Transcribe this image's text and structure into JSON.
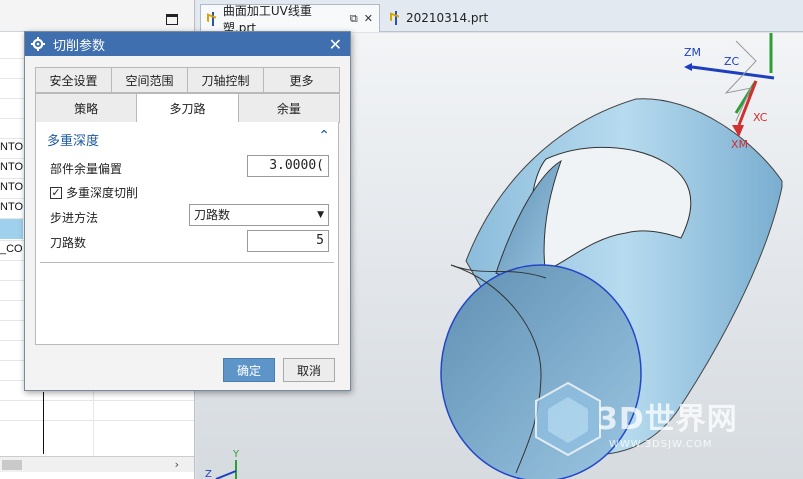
{
  "navigator": {
    "rows": [
      "NTO",
      "NTO",
      "NTO",
      "NTO",
      "_CO"
    ]
  },
  "tabs": [
    {
      "label": "曲面加工UV线重塑.prt",
      "active": true
    },
    {
      "label": "20210314.prt",
      "active": false
    }
  ],
  "dialog": {
    "title": "切削参数",
    "tabs_row1": [
      "安全设置",
      "空间范围",
      "刀轴控制",
      "更多"
    ],
    "tabs_row2": [
      "策略",
      "多刀路",
      "余量"
    ],
    "active_tab": "多刀路",
    "group": {
      "title": "多重深度",
      "part_stock_label": "部件余量偏置",
      "part_stock_value": "3.0000(",
      "multi_depth_label": "多重深度切削",
      "multi_depth_checked": true,
      "step_method_label": "步进方法",
      "step_method_value": "刀路数",
      "passes_label": "刀路数",
      "passes_value": "5"
    },
    "ok_label": "确定",
    "cancel_label": "取消"
  },
  "viewport": {
    "csys_labels": {
      "zm": "ZM",
      "zc": "ZC",
      "xc": "XC",
      "xm": "XM",
      "y": "Y",
      "z": "Z"
    },
    "watermark": "3D世界网",
    "watermark_url": "WWW.3DSJW.COM"
  },
  "colors": {
    "dialog_title": "#3f6fae",
    "accent": "#1e5aa0",
    "surface": "#a9d0e8",
    "edge": "#2246c8"
  }
}
